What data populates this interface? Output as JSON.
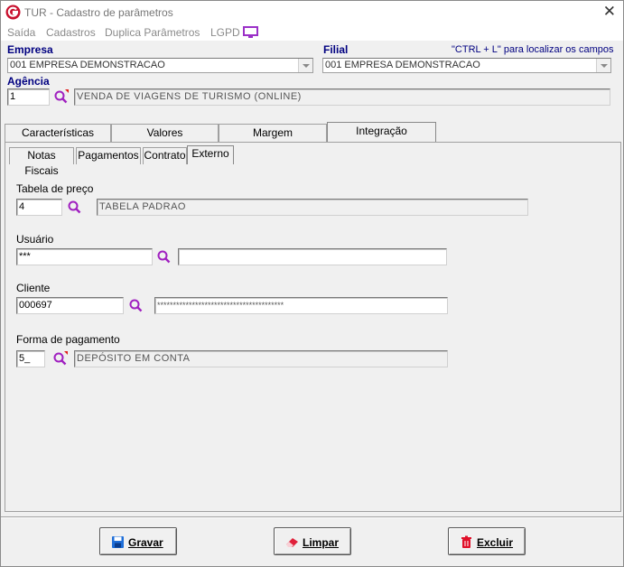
{
  "window": {
    "title": "TUR - Cadastro de parâmetros"
  },
  "menu": {
    "items": [
      "Saída",
      "Cadastros",
      "Duplica Parâmetros",
      "LGPD"
    ]
  },
  "empresa": {
    "label": "Empresa",
    "value": "001 EMPRESA DEMONSTRACAO"
  },
  "filial": {
    "label": "Filial",
    "value": "001 EMPRESA DEMONSTRACAO",
    "hint": "\"CTRL + L\" para localizar os campos"
  },
  "agencia": {
    "label": "Agência",
    "code": "1",
    "description": "VENDA DE VIAGENS DE TURISMO (ONLINE)"
  },
  "tabs": [
    "Características",
    "Valores",
    "Margem",
    "Integração"
  ],
  "subtabs": [
    "Notas Fiscais",
    "Pagamentos",
    "Contrato",
    "Externo"
  ],
  "form": {
    "tabela": {
      "label": "Tabela de preço",
      "code": "4",
      "description": "TABELA PADRAO"
    },
    "usuario": {
      "label": "Usuário",
      "code": "***",
      "description": ""
    },
    "cliente": {
      "label": "Cliente",
      "code": "000697",
      "description": "****************************************"
    },
    "forma": {
      "label": "Forma de pagamento",
      "code": "5_",
      "description": "DEPÓSITO EM CONTA"
    }
  },
  "buttons": {
    "gravar": "Gravar",
    "limpar": "Limpar",
    "excluir": "Excluir"
  },
  "colors": {
    "accent_blue": "#000080",
    "lupa_purple": "#a020c0",
    "logo_red": "#c8102e"
  }
}
